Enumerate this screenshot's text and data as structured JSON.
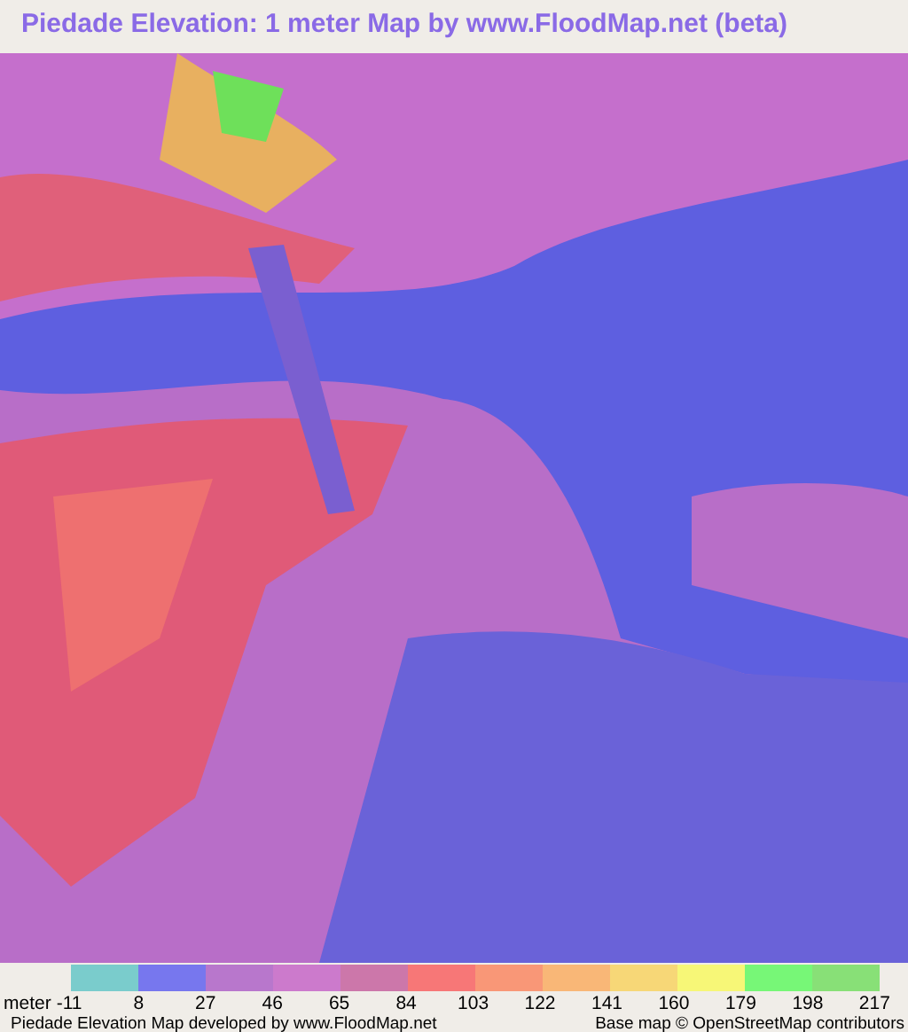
{
  "title": "Piedade Elevation: 1 meter Map by www.FloodMap.net (beta)",
  "legend": {
    "unit": "meter",
    "swatches": [
      {
        "color": "#7acccc"
      },
      {
        "color": "#7777ee"
      },
      {
        "color": "#b877cc"
      },
      {
        "color": "#cc7acc"
      },
      {
        "color": "#cc77aa"
      },
      {
        "color": "#f77777"
      },
      {
        "color": "#f99777"
      },
      {
        "color": "#f9b777"
      },
      {
        "color": "#f7d777"
      },
      {
        "color": "#f7f777"
      },
      {
        "color": "#77f777"
      },
      {
        "color": "#88e077"
      }
    ],
    "ticks": [
      "-11",
      "8",
      "27",
      "46",
      "65",
      "84",
      "103",
      "122",
      "141",
      "160",
      "179",
      "198",
      "217"
    ]
  },
  "footer": {
    "credit": "Piedade Elevation Map developed by www.FloodMap.net",
    "attribution": "Base map © OpenStreetMap contributors"
  }
}
